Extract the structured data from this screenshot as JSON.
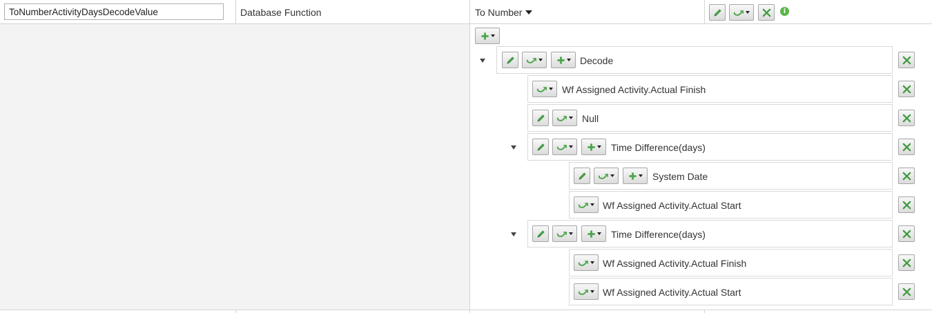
{
  "header": {
    "name_value": "ToNumberActivityDaysDecodeValue",
    "type_label": "Database Function",
    "function_label": "To Number"
  },
  "icons": {
    "edit": "pencil-icon",
    "function": "function-dropdown-icon",
    "add": "plus-icon",
    "delete": "delete-x-icon",
    "info": "info-icon"
  },
  "colors": {
    "accent_green": "#59b548",
    "icon_green": "#4ca64c",
    "delete_green": "#3f9a3f"
  },
  "tree": {
    "nodes": [
      {
        "id": "decode",
        "label": "Decode"
      },
      {
        "id": "wf-actual-finish-1",
        "label": "Wf Assigned Activity.Actual Finish"
      },
      {
        "id": "null",
        "label": "Null"
      },
      {
        "id": "time-diff-1",
        "label": "Time Difference(days)"
      },
      {
        "id": "system-date",
        "label": "System Date"
      },
      {
        "id": "wf-actual-start-1",
        "label": "Wf Assigned Activity.Actual Start"
      },
      {
        "id": "time-diff-2",
        "label": "Time Difference(days)"
      },
      {
        "id": "wf-actual-finish-2",
        "label": "Wf Assigned Activity.Actual Finish"
      },
      {
        "id": "wf-actual-start-2",
        "label": "Wf Assigned Activity.Actual Start"
      }
    ]
  }
}
